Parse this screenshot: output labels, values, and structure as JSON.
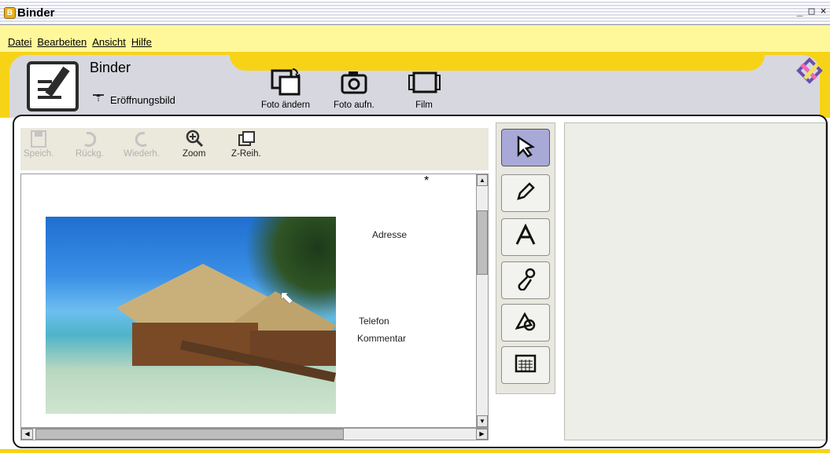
{
  "window": {
    "title": "Binder",
    "controls": [
      "_",
      "□",
      "×"
    ]
  },
  "menu": {
    "items": [
      "Datei",
      "Bearbeiten",
      "Ansicht",
      "Hilfe"
    ]
  },
  "header": {
    "app_title": "Binder",
    "open_label": "Eröffnungsbild",
    "buttons": [
      {
        "label": "Foto ändern",
        "icon": "photo-change-icon"
      },
      {
        "label": "Foto aufn.",
        "icon": "camera-icon"
      },
      {
        "label": "Film",
        "icon": "film-icon"
      }
    ]
  },
  "toolbar": {
    "buttons": [
      {
        "label": "Speich.",
        "icon": "save-icon",
        "enabled": false
      },
      {
        "label": "Rückg.",
        "icon": "undo-icon",
        "enabled": false
      },
      {
        "label": "Wiederh.",
        "icon": "redo-icon",
        "enabled": false
      },
      {
        "label": "Zoom",
        "icon": "zoom-icon",
        "enabled": true
      },
      {
        "label": "Z-Reih.",
        "icon": "z-order-icon",
        "enabled": true
      }
    ]
  },
  "canvas": {
    "star": "*",
    "fields": {
      "address": "Adresse",
      "phone": "Telefon",
      "comment": "Kommentar"
    }
  },
  "tools": [
    {
      "name": "select-arrow-tool-icon",
      "glyph": "⬉",
      "selected": true
    },
    {
      "name": "pencil-tool-icon",
      "glyph": "✎",
      "selected": false
    },
    {
      "name": "text-tool-icon",
      "glyph": "A",
      "selected": false
    },
    {
      "name": "stamp-tool-icon",
      "glyph": "⚲",
      "selected": false
    },
    {
      "name": "shapes-tool-icon",
      "glyph": "⬠",
      "selected": false
    },
    {
      "name": "calendar-tool-icon",
      "glyph": "▦",
      "selected": false
    }
  ],
  "colors": {
    "accent_yellow": "#f7d318",
    "menu_yellow": "#fff89a",
    "panel_gray": "#d7d7df",
    "selected_tool": "#a9a9d8"
  }
}
